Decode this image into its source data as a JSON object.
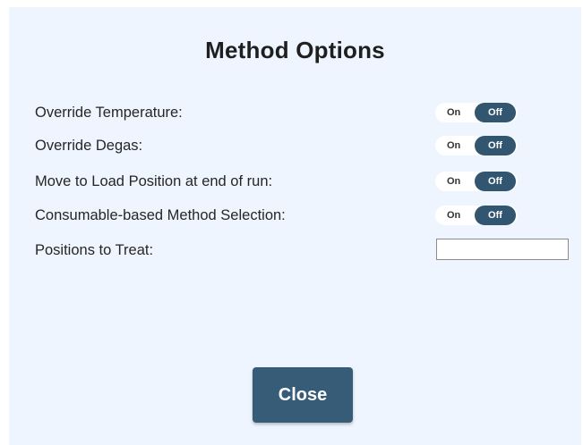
{
  "dialog": {
    "title": "Method Options",
    "close_label": "Close"
  },
  "options": [
    {
      "label": "Override Temperature:",
      "on_label": "On",
      "off_label": "Off",
      "state": "Off"
    },
    {
      "label": "Override Degas:",
      "on_label": "On",
      "off_label": "Off",
      "state": "Off"
    },
    {
      "label": "Move to Load Position at end of run:",
      "on_label": "On",
      "off_label": "Off",
      "state": "Off"
    },
    {
      "label": "Consumable-based Method Selection:",
      "on_label": "On",
      "off_label": "Off",
      "state": "Off"
    }
  ],
  "positions_to_treat": {
    "label": "Positions to Treat:",
    "value": ""
  },
  "colors": {
    "dialog_background": "#eef5fe",
    "accent": "#335670",
    "button": "#365c78"
  }
}
